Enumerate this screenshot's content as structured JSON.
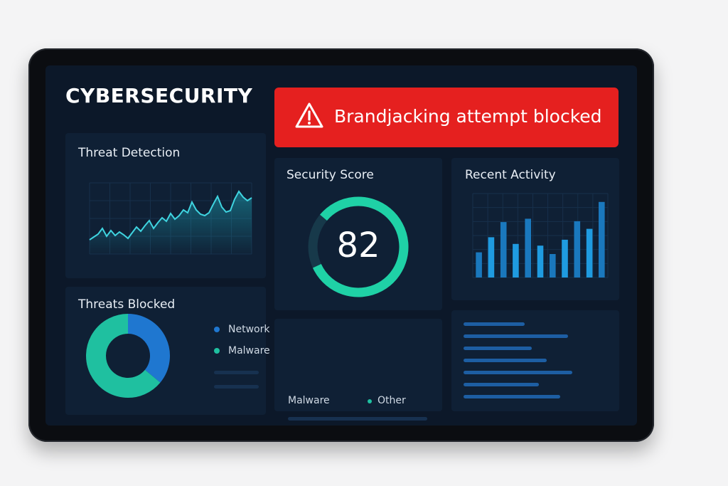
{
  "app": {
    "title": "CYBERSECURITY"
  },
  "alert": {
    "icon": "warning-triangle-icon",
    "message": "Brandjacking attempt blocked",
    "color": "#e5201f"
  },
  "threat_detection": {
    "title": "Threat Detection",
    "series": [
      20,
      24,
      28,
      36,
      25,
      33,
      26,
      31,
      27,
      22,
      30,
      38,
      32,
      40,
      47,
      36,
      44,
      51,
      46,
      57,
      49,
      54,
      62,
      58,
      73,
      62,
      56,
      54,
      58,
      70,
      81,
      66,
      59,
      61,
      77,
      88,
      80,
      75,
      79
    ]
  },
  "security_score": {
    "title": "Security Score",
    "value": "82",
    "score": 82,
    "max": 100,
    "accent": "#1fd1a6"
  },
  "recent_activity": {
    "title": "Recent Activity",
    "bars": [
      30,
      48,
      66,
      40,
      70,
      38,
      28,
      45,
      67,
      58,
      90
    ],
    "accent": "#1f8fd6"
  },
  "threats_blocked": {
    "title": "Threats Blocked",
    "legend": [
      {
        "label": "Network",
        "color": "#1f77d0"
      },
      {
        "label": "Malware",
        "color": "#1fc0a0"
      }
    ],
    "slices": [
      {
        "name": "Network",
        "value": 36,
        "color": "#1f77d0"
      },
      {
        "name": "Malware",
        "value": 64,
        "color": "#1fc0a0"
      }
    ]
  },
  "secondary_legend": {
    "items": [
      {
        "label": "Malware",
        "color": ""
      },
      {
        "label": "Other",
        "color": "#1fc0a0"
      }
    ]
  }
}
